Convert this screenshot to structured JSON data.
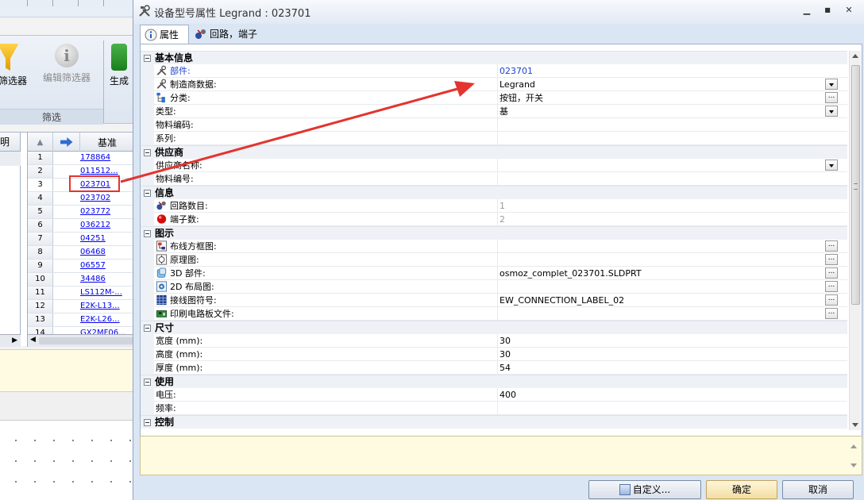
{
  "background": {
    "ribbon": {
      "buttons": [
        {
          "label": "加筛选器",
          "icon": "funnel-icon"
        },
        {
          "label": "编辑筛选器",
          "icon": "info-icon"
        },
        {
          "label": "生成",
          "icon": "generate-icon"
        }
      ],
      "group_label": "筛选"
    },
    "left_pane_header": "明",
    "table": {
      "header_base": "基准",
      "rows": [
        {
          "num": "1",
          "code": "178864"
        },
        {
          "num": "2",
          "code": "011512..."
        },
        {
          "num": "3",
          "code": "023701"
        },
        {
          "num": "4",
          "code": "023702"
        },
        {
          "num": "5",
          "code": "023772"
        },
        {
          "num": "6",
          "code": "036212"
        },
        {
          "num": "7",
          "code": "04251"
        },
        {
          "num": "8",
          "code": "06468"
        },
        {
          "num": "9",
          "code": "06557"
        },
        {
          "num": "10",
          "code": "34486"
        },
        {
          "num": "11",
          "code": "LS112M-..."
        },
        {
          "num": "12",
          "code": "E2K-L13..."
        },
        {
          "num": "13",
          "code": "E2K-L26..."
        },
        {
          "num": "14",
          "code": "GX2MF06..."
        }
      ]
    }
  },
  "dialog": {
    "title": "设备型号属性 Legrand : 023701",
    "window_buttons": {
      "minimize": "▁",
      "maximize": "■",
      "close": "✕"
    },
    "tabs": [
      {
        "label": "属性",
        "icon": "info-icon"
      },
      {
        "label": "回路，端子",
        "icon": "circuit-icon"
      }
    ],
    "categories": {
      "basic": "基本信息",
      "supplier": "供应商",
      "info": "信息",
      "graphics": "图示",
      "size": "尺寸",
      "usage": "使用",
      "control": "控制"
    },
    "properties": {
      "part": {
        "name": "部件:",
        "value": "023701"
      },
      "manufacturer": {
        "name": "制造商数据:",
        "value": "Legrand"
      },
      "classification": {
        "name": "分类:",
        "value": "按钮，开关"
      },
      "type": {
        "name": "类型:",
        "value": "基"
      },
      "material_code": {
        "name": "物料编码:",
        "value": ""
      },
      "series": {
        "name": "系列:",
        "value": ""
      },
      "supplier_name": {
        "name": "供应商名称:",
        "value": ""
      },
      "material_number": {
        "name": "物料编号:",
        "value": ""
      },
      "circuit_count": {
        "name": "回路数目:",
        "value": "1"
      },
      "terminal_count": {
        "name": "端子数:",
        "value": "2"
      },
      "wiring_frame": {
        "name": "布线方框图:",
        "value": ""
      },
      "schematic": {
        "name": "原理图:",
        "value": ""
      },
      "part_3d": {
        "name": "3D 部件:",
        "value": "osmoz_complet_023701.SLDPRT"
      },
      "layout_2d": {
        "name": "2D 布局图:",
        "value": ""
      },
      "wiring_symbol": {
        "name": "接线图符号:",
        "value": "EW_CONNECTION_LABEL_02"
      },
      "pcb_file": {
        "name": "印刷电路板文件:",
        "value": ""
      },
      "width": {
        "name": "宽度 (mm):",
        "value": "30"
      },
      "height": {
        "name": "高度 (mm):",
        "value": "30"
      },
      "depth": {
        "name": "厚度 (mm):",
        "value": "54"
      },
      "voltage": {
        "name": "电压:",
        "value": "400"
      },
      "frequency": {
        "name": "频率:",
        "value": ""
      }
    },
    "buttons": {
      "customize": "自定义...",
      "ok": "确定",
      "cancel": "取消"
    },
    "colors": {
      "annotation_red": "#e3342f",
      "link_blue": "#1c3fd0"
    }
  }
}
